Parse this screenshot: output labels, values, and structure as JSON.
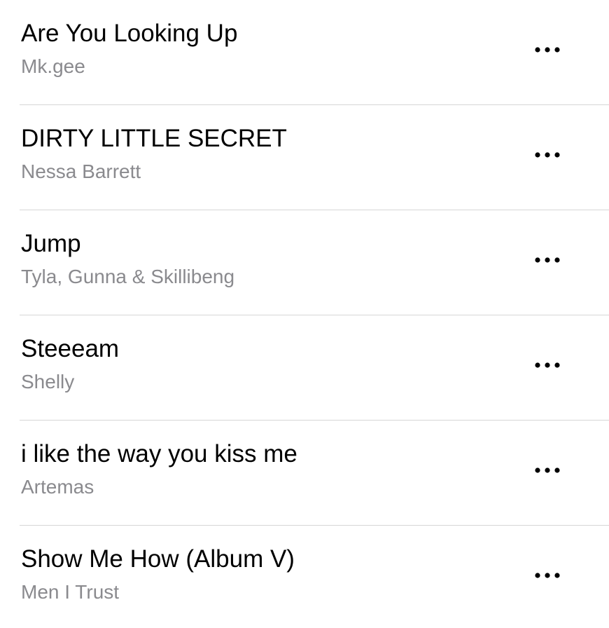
{
  "songs": [
    {
      "title": "Are You Looking Up",
      "artist": "Mk.gee"
    },
    {
      "title": "DIRTY LITTLE SECRET",
      "artist": "Nessa Barrett"
    },
    {
      "title": "Jump",
      "artist": "Tyla, Gunna & Skillibeng"
    },
    {
      "title": "Steeeam",
      "artist": "Shelly"
    },
    {
      "title": "i like the way you kiss me",
      "artist": "Artemas"
    },
    {
      "title": "Show Me How (Album V)",
      "artist": "Men I Trust"
    }
  ],
  "icons": {
    "more": "more-horizontal-icon"
  },
  "colors": {
    "title": "#000000",
    "artist": "#8a8a8e",
    "separator": "#d6d6d6"
  }
}
